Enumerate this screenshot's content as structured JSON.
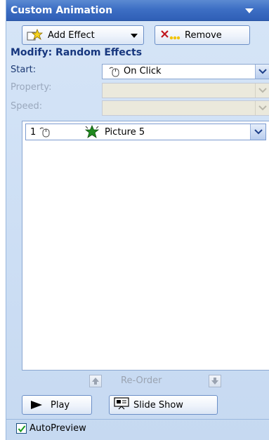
{
  "panel": {
    "title": "Custom Animation",
    "add_effect_label": "Add Effect",
    "remove_label": "Remove",
    "modify_label": "Modify: Random Effects",
    "start_label": "Start:",
    "start_value": "On Click",
    "property_label": "Property:",
    "speed_label": "Speed:",
    "effects": [
      {
        "index": "1",
        "name": "Picture 5"
      }
    ],
    "reorder_label": "Re-Order",
    "play_label": "Play",
    "slideshow_label": "Slide Show",
    "autopreview_label": "AutoPreview",
    "autopreview_checked": true
  },
  "colors": {
    "titlebar": "#3d6fc4",
    "pane_bg": "#cfe0f5",
    "modify_text": "#17377e",
    "disabled_text": "#9aa8bd",
    "effect_star": "#1f8a1f"
  },
  "icons": [
    "menu-arrow-icon",
    "add-effect-star-icon",
    "remove-x-icon",
    "mouse-click-icon",
    "chevron-down-icon",
    "effect-star-icon",
    "arrow-up-icon",
    "arrow-down-icon",
    "play-icon",
    "slideshow-icon",
    "checkmark-icon"
  ]
}
